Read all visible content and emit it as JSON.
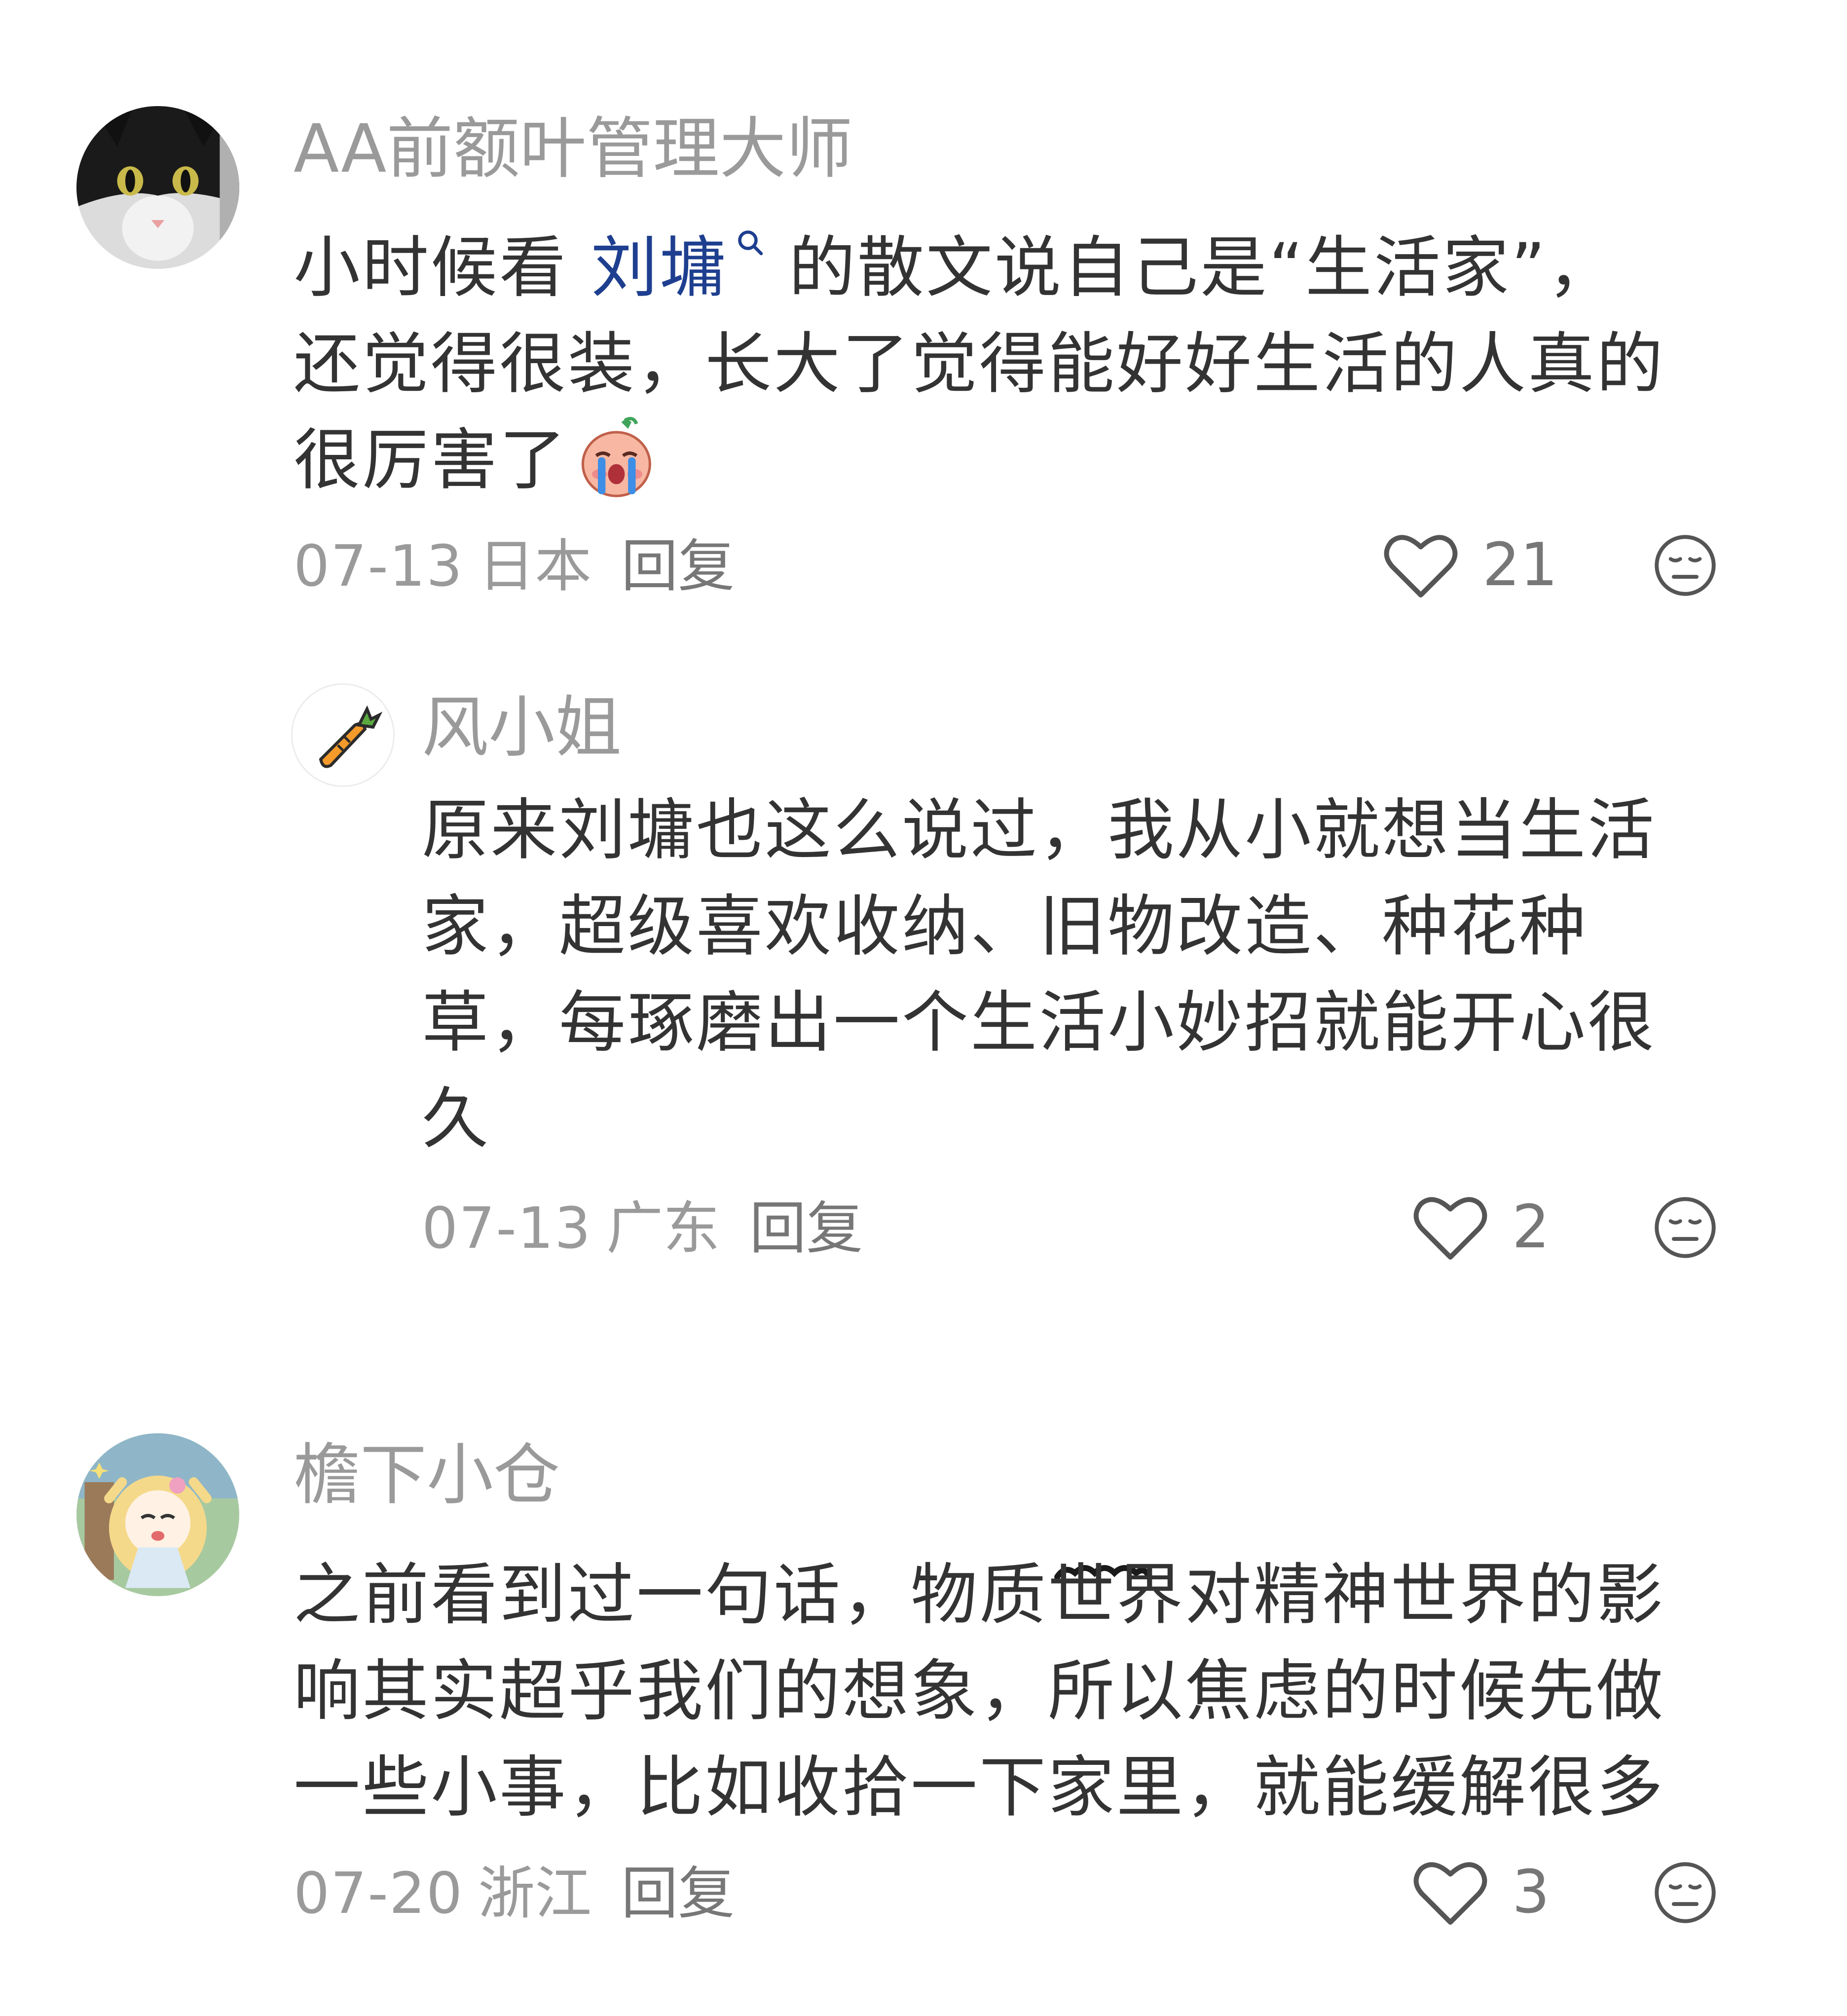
{
  "comments": [
    {
      "username": "AA前额叶管理大师",
      "body_lines": [
        {
          "pre": "小时候看 ",
          "mention": "刘墉",
          "post": " 的散文说自己是“生活家”，"
        },
        {
          "text": "还觉得很装，长大了觉得能好好生活的人真的"
        },
        {
          "text": "很厉害了"
        }
      ],
      "emoji": "crying-face-emoji",
      "date": "07-13",
      "region": "日本",
      "reply_label": "回复",
      "like_count": "21",
      "reply": {
        "username": "风小姐",
        "body_lines": [
          "原来刘墉也这么说过，我从小就想当生活",
          "家，超级喜欢收纳、旧物改造、种花种",
          "草，每琢磨出一个生活小妙招就能开心很",
          "久"
        ],
        "date": "07-13",
        "region": "广东",
        "reply_label": "回复",
        "like_count": "2"
      }
    },
    {
      "username": "檐下小仓",
      "body_lines": [
        "之前看到过一句话，物质世界对精神世界的影",
        "响其实超乎我们的想象，所以焦虑的时候先做",
        "一些小事，比如收拾一下家里，就能缓解很多"
      ],
      "date": "07-20",
      "region": "浙江",
      "reply_label": "回复",
      "like_count": "3"
    }
  ],
  "colors": {
    "username": "#9a9a9a",
    "body": "#333333",
    "mention": "#1e3f8f",
    "meta": "#9a9a9a"
  },
  "icons": {
    "like": "heart-outline-icon",
    "dislike": "neutral-face-icon",
    "mention_search": "search-icon"
  }
}
